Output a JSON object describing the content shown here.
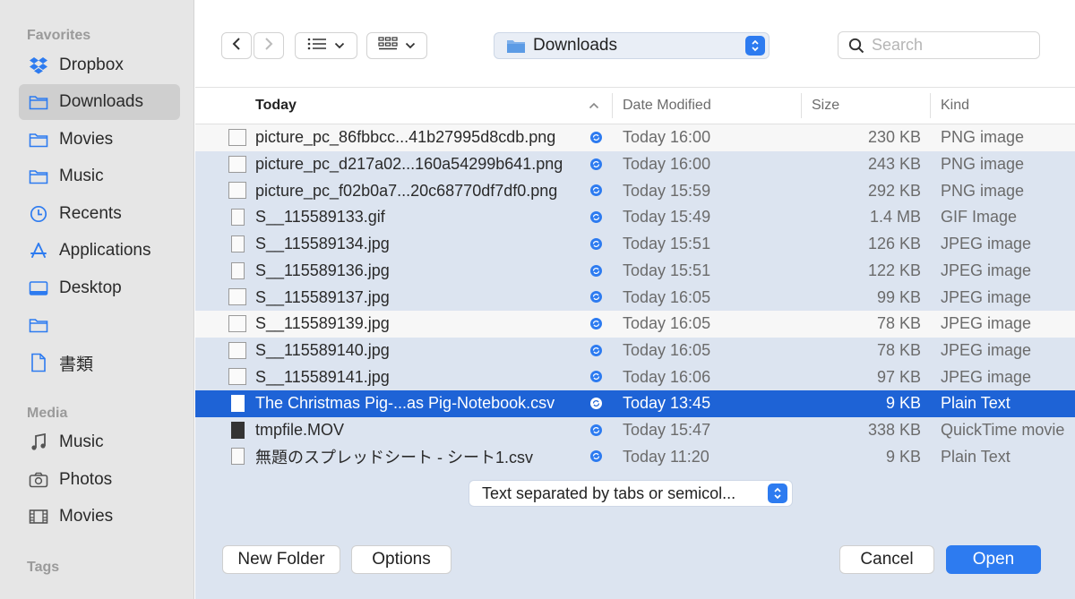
{
  "sidebar": {
    "favorites_label": "Favorites",
    "favorites": [
      {
        "label": "Dropbox",
        "icon": "dropbox-icon"
      },
      {
        "label": "Downloads",
        "icon": "folder-icon",
        "active": true
      },
      {
        "label": "Movies",
        "icon": "folder-icon"
      },
      {
        "label": "Music",
        "icon": "folder-icon"
      },
      {
        "label": "Recents",
        "icon": "clock-icon"
      },
      {
        "label": "Applications",
        "icon": "applications-icon"
      },
      {
        "label": "Desktop",
        "icon": "desktop-icon"
      },
      {
        "label": "",
        "icon": "folder-icon"
      },
      {
        "label": "書類",
        "icon": "document-icon"
      }
    ],
    "media_label": "Media",
    "media": [
      {
        "label": "Music",
        "icon": "music-note-icon"
      },
      {
        "label": "Photos",
        "icon": "camera-icon"
      },
      {
        "label": "Movies",
        "icon": "film-icon"
      }
    ],
    "tags_label": "Tags"
  },
  "toolbar": {
    "path": "Downloads",
    "search_placeholder": "Search"
  },
  "columns": {
    "name": "Today",
    "date": "Date Modified",
    "size": "Size",
    "kind": "Kind"
  },
  "files": [
    {
      "name": "picture_pc_86fbbcc...41b27995d8cdb.png",
      "date": "Today 16:00",
      "size": "230 KB",
      "kind": "PNG image",
      "icon": "image"
    },
    {
      "name": "picture_pc_d217a02...160a54299b641.png",
      "date": "Today 16:00",
      "size": "243 KB",
      "kind": "PNG image",
      "icon": "image"
    },
    {
      "name": "picture_pc_f02b0a7...20c68770df7df0.png",
      "date": "Today 15:59",
      "size": "292 KB",
      "kind": "PNG image",
      "icon": "image"
    },
    {
      "name": "S__115589133.gif",
      "date": "Today 15:49",
      "size": "1.4 MB",
      "kind": "GIF Image",
      "icon": "doc"
    },
    {
      "name": "S__115589134.jpg",
      "date": "Today 15:51",
      "size": "126 KB",
      "kind": "JPEG image",
      "icon": "doc"
    },
    {
      "name": "S__115589136.jpg",
      "date": "Today 15:51",
      "size": "122 KB",
      "kind": "JPEG image",
      "icon": "doc"
    },
    {
      "name": "S__115589137.jpg",
      "date": "Today 16:05",
      "size": "99 KB",
      "kind": "JPEG image",
      "icon": "image"
    },
    {
      "name": "S__115589139.jpg",
      "date": "Today 16:05",
      "size": "78 KB",
      "kind": "JPEG image",
      "icon": "image"
    },
    {
      "name": "S__115589140.jpg",
      "date": "Today 16:05",
      "size": "78 KB",
      "kind": "JPEG image",
      "icon": "image"
    },
    {
      "name": "S__115589141.jpg",
      "date": "Today 16:06",
      "size": "97 KB",
      "kind": "JPEG image",
      "icon": "image"
    },
    {
      "name": "The Christmas Pig-...as Pig-Notebook.csv",
      "date": "Today 13:45",
      "size": "9 KB",
      "kind": "Plain Text",
      "icon": "doc"
    },
    {
      "name": "tmpfile.MOV",
      "date": "Today 15:47",
      "size": "338 KB",
      "kind": "QuickTime movie",
      "icon": "mov"
    },
    {
      "name": "無題のスプレッドシート - シート1.csv",
      "date": "Today 11:20",
      "size": "9 KB",
      "kind": "Plain Text",
      "icon": "doc"
    }
  ],
  "selected_index": 10,
  "format_popup": "Text separated by tabs or semicol...",
  "buttons": {
    "new_folder": "New Folder",
    "options": "Options",
    "cancel": "Cancel",
    "open": "Open"
  },
  "colors": {
    "accent": "#2d7bf0",
    "selection": "#1e63d6",
    "row_tint": "#dce4f0"
  }
}
